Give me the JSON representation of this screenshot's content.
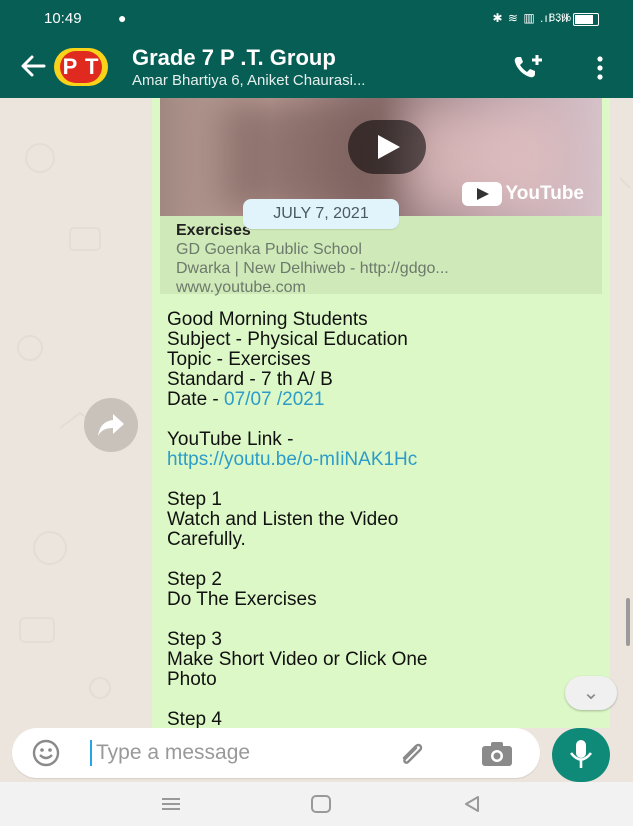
{
  "status_bar": {
    "time": "10:49",
    "battery": "83%"
  },
  "header": {
    "avatar_text": "P T",
    "title": "Grade 7  P .T. Group",
    "subtitle": "Amar Bhartiya 6, Aniket Chaurasi..."
  },
  "video_preview": {
    "date_badge": "JULY 7, 2021",
    "brand": "YouTube",
    "card_title": "Exercises",
    "card_desc1": "GD Goenka Public School",
    "card_desc2": "Dwarka | New Delhiweb - http://gdgo...",
    "card_domain": "www.youtube.com"
  },
  "message": {
    "line1": "Good Morning Students",
    "line2": "Subject - Physical Education",
    "line3": "Topic - Exercises",
    "line4": "Standard - 7  th A/ B",
    "date_label": "Date - ",
    "date_value": "07/07 /2021",
    "yt_label": "YouTube Link -",
    "yt_url": "https://youtu.be/o-mIiNAK1Hc",
    "step1_title": "Step 1",
    "step1_l1": "Watch and Listen the Video",
    "step1_l2": "Carefully.",
    "step2_title": "Step 2",
    "step2_l1": "Do The Exercises",
    "step3_title": "Step 3",
    "step3_l1": "Make Short Video or Click One",
    "step3_l2": "Photo",
    "step4_title": "Step 4"
  },
  "composer": {
    "placeholder": "Type a message"
  },
  "colors": {
    "header": "#075e54",
    "bubble": "#dcf8c6",
    "link": "#2d9cc9",
    "fab": "#0f8a78"
  }
}
